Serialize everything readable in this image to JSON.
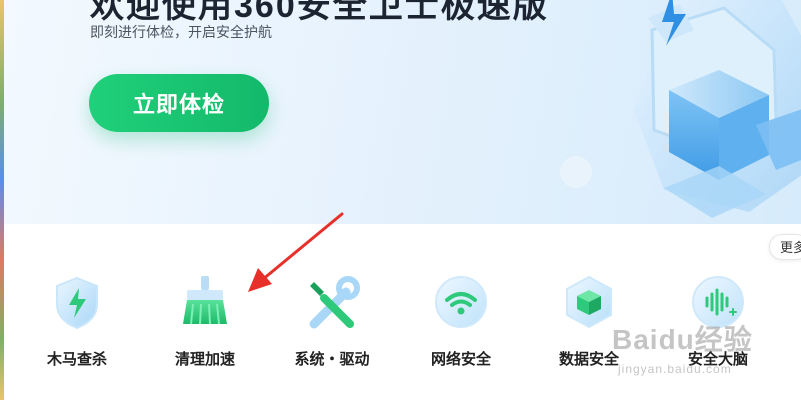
{
  "hero": {
    "title": "欢迎使用360安全卫士极速版",
    "subtitle": "即刻进行体检，开启安全护航",
    "cta_label": "立即体检"
  },
  "more_label": "更多",
  "tools": [
    {
      "label": "木马查杀",
      "icon": "trojan-scan-icon"
    },
    {
      "label": "清理加速",
      "icon": "broom-cleanup-icon"
    },
    {
      "label": "系统・驱动",
      "icon": "tools-wrench-icon"
    },
    {
      "label": "网络安全",
      "icon": "wifi-shield-icon"
    },
    {
      "label": "数据安全",
      "icon": "data-cube-icon"
    },
    {
      "label": "安全大脑",
      "icon": "brain-wave-icon"
    }
  ],
  "watermark": {
    "logo": "Baidu经验",
    "url": "jingyan.baidu.com"
  },
  "colors": {
    "accent_green": "#13b96a",
    "annotation_red": "#e8302a",
    "hero_bg": "#e6f2fd"
  }
}
